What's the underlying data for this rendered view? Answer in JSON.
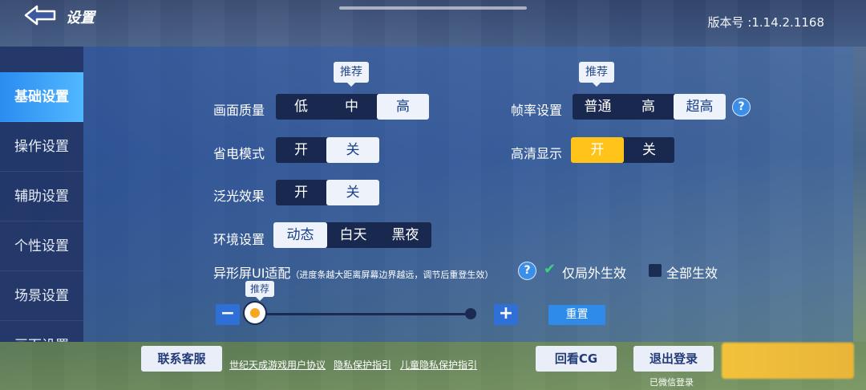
{
  "header": {
    "title": "设置",
    "version": "版本号 :1.14.2.1168"
  },
  "sidebar": {
    "items": [
      {
        "label": "基础设置",
        "active": true
      },
      {
        "label": "操作设置"
      },
      {
        "label": "辅助设置"
      },
      {
        "label": "个性设置"
      },
      {
        "label": "场景设置"
      },
      {
        "label": "画面设置"
      }
    ]
  },
  "settings": {
    "recommend_label": "推荐",
    "quality": {
      "label": "画面质量",
      "options": [
        "低",
        "中",
        "高"
      ],
      "selected": "高"
    },
    "frame_rate": {
      "label": "帧率设置",
      "options": [
        "普通",
        "高",
        "超高"
      ],
      "selected": "超高"
    },
    "power_saving": {
      "label": "省电模式",
      "options": [
        "开",
        "关"
      ],
      "selected": "关"
    },
    "hd_display": {
      "label": "高清显示",
      "options": [
        "开",
        "关"
      ],
      "selected": "开"
    },
    "bloom": {
      "label": "泛光效果",
      "options": [
        "开",
        "关"
      ],
      "selected": "关"
    },
    "environment": {
      "label": "环境设置",
      "options": [
        "动态",
        "白天",
        "黑夜"
      ],
      "selected": "动态"
    },
    "notch": {
      "label": "异形屏UI适配",
      "hint": "（进度条越大距离屏幕边界越远，调节后重登生效）",
      "option_in_game": "仅局外生效",
      "option_all": "全部生效",
      "selected": "仅局外生效",
      "slider_value": 0,
      "minus": "−",
      "plus": "+",
      "reset": "重置"
    }
  },
  "footer": {
    "support": "联系客服",
    "link_terms": "世纪天成游戏用户协议",
    "link_privacy": "隐私保护指引",
    "link_child_privacy": "儿童隐私保护指引",
    "replay_cg": "回看CG",
    "logout": "退出登录",
    "login_note": "已微信登录"
  },
  "colors": {
    "accent_blue": "#2e8bea",
    "selected_yellow": "#ffc31a",
    "segment_bg": "#18284e"
  }
}
